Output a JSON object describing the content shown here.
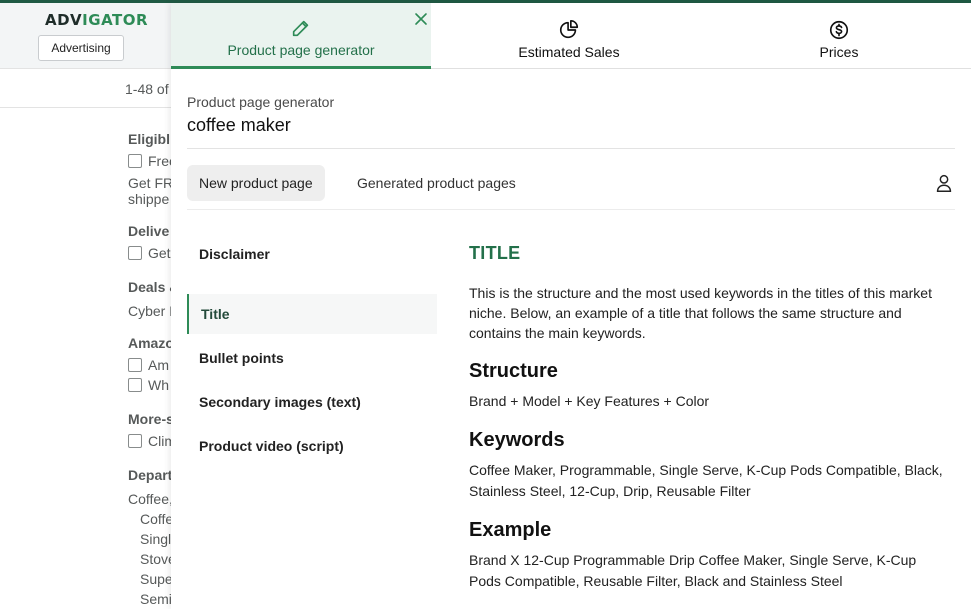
{
  "brand": {
    "name_part1": "ADV",
    "name_part2": "IGATOR",
    "advertising_label": "Advertising"
  },
  "background": {
    "results_text": "1-48 of",
    "filters": {
      "eligible_heading": "Eligibl",
      "free_label": "Free",
      "free_desc_line1": "Get FR",
      "free_desc_line2": "shippe",
      "delivery_heading": "Delive",
      "delivery_option": "Get",
      "deals_heading": "Deals &",
      "deals_option": "Cyber M",
      "amazon_heading": "Amazo",
      "amazon_option1": "Am",
      "amazon_option2": "Wh",
      "more_heading": "More-s",
      "more_option": "Clim",
      "department_heading": "Depart",
      "department_parent": "Coffee,",
      "department_items": [
        "Coffe",
        "Singl",
        "Stove",
        "Supe",
        "Semi"
      ]
    }
  },
  "tabs": [
    {
      "label": "Product page generator",
      "icon": "edit-icon"
    },
    {
      "label": "Estimated Sales",
      "icon": "pie-chart-icon"
    },
    {
      "label": "Prices",
      "icon": "dollar-circle-icon"
    }
  ],
  "context": {
    "label": "Product page generator",
    "query": "coffee maker"
  },
  "subnav": {
    "new_page": "New product page",
    "generated_pages": "Generated product pages"
  },
  "sidenav": {
    "items": [
      {
        "label": "Disclaimer"
      },
      {
        "label": "Title"
      },
      {
        "label": "Bullet points"
      },
      {
        "label": "Secondary images (text)"
      },
      {
        "label": "Product video (script)"
      }
    ]
  },
  "content": {
    "title": "TITLE",
    "intro": "This is the structure and the most used keywords in the titles of this market niche. Below, an example of a title that follows the same structure and contains the main keywords.",
    "structure_heading": "Structure",
    "structure_text": "Brand + Model + Key Features + Color",
    "keywords_heading": "Keywords",
    "keywords_text": "Coffee Maker, Programmable, Single Serve, K-Cup Pods Compatible, Black, Stainless Steel, 12-Cup, Drip, Reusable Filter",
    "example_heading": "Example",
    "example_text": "Brand X 12-Cup Programmable Drip Coffee Maker, Single Serve, K-Cup Pods Compatible, Reusable Filter, Black and Stainless Steel"
  },
  "colors": {
    "accent": "#2e8b57",
    "accent_dark": "#23704a",
    "top_strip": "#1f5a44"
  }
}
